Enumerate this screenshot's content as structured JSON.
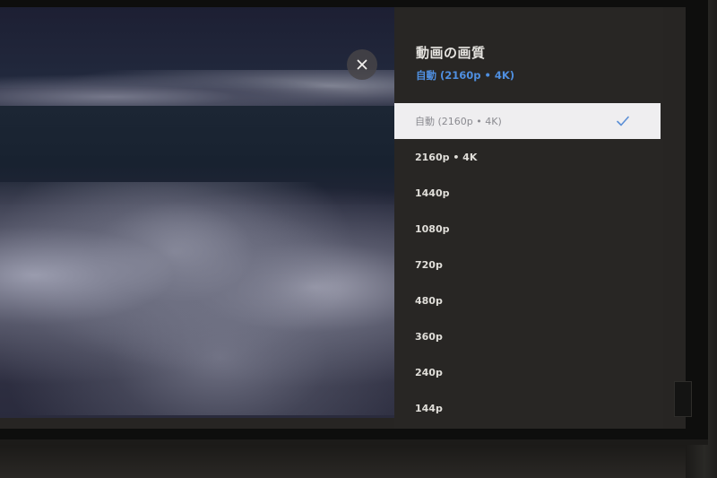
{
  "panel": {
    "title": "動画の画質",
    "current": "自動 (2160p • 4K)",
    "options": [
      "自動 (2160p • 4K)",
      "2160p • 4K",
      "1440p",
      "1080p",
      "720p",
      "480p",
      "360p",
      "240p",
      "144p"
    ],
    "selected_index": 0
  },
  "colors": {
    "accent": "#4f8fe0",
    "panel_bg": "#282624",
    "selected_bg": "#efeef0",
    "check": "#5b8fd6"
  },
  "icons": {
    "close": "close-icon",
    "selected": "check-icon"
  }
}
